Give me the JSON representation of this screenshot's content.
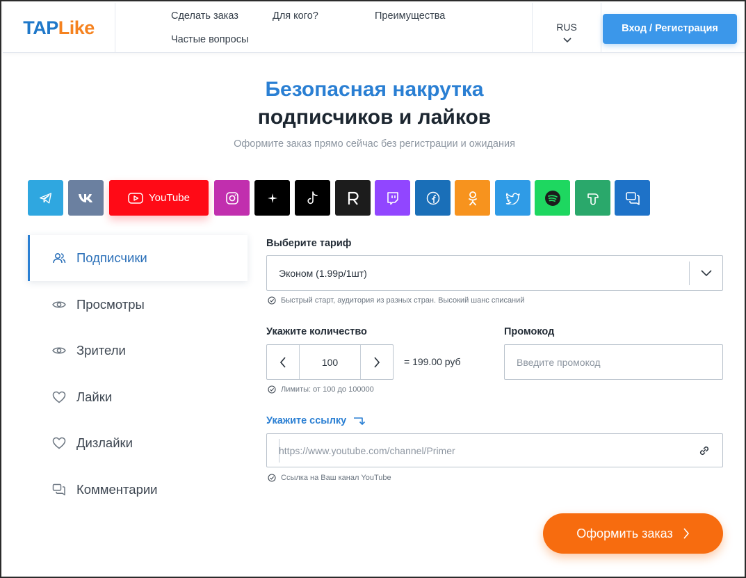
{
  "logo": {
    "part1": "TAP",
    "part2": "Like"
  },
  "nav": {
    "order": "Сделать заказ",
    "for_whom": "Для кого?",
    "advantages": "Преимущества",
    "faq": "Частые вопросы"
  },
  "language": "RUS",
  "login_label": "Вход / Регистрация",
  "hero": {
    "title_line1": "Безопасная накрутка",
    "title_line2": "подписчиков и лайков",
    "subtitle": "Оформите заказ прямо сейчас без регистрации и ожидания"
  },
  "platforms": [
    {
      "icon": "telegram-icon",
      "color": "#2fa7e0"
    },
    {
      "icon": "vk-icon",
      "color": "#6b80a0"
    },
    {
      "icon": "youtube-icon",
      "color": "#ff0a16",
      "label": "YouTube",
      "selected": true
    },
    {
      "icon": "instagram-icon",
      "color": "#c12fae"
    },
    {
      "icon": "threads-icon",
      "color": "#000000"
    },
    {
      "icon": "tiktok-icon",
      "color": "#000000"
    },
    {
      "icon": "rutube-icon",
      "color": "#1c1c1c"
    },
    {
      "icon": "twitch-icon",
      "color": "#9146ff"
    },
    {
      "icon": "facebook-icon",
      "color": "#1a6fb8"
    },
    {
      "icon": "odnoklassniki-icon",
      "color": "#f7931e"
    },
    {
      "icon": "twitter-icon",
      "color": "#2f9be6"
    },
    {
      "icon": "spotify-icon",
      "color": "#1ed760"
    },
    {
      "icon": "tenchat-icon",
      "color": "#2aa86b"
    },
    {
      "icon": "comments-icon",
      "color": "#1e72c8"
    }
  ],
  "services": [
    {
      "label": "Подписчики",
      "icon": "users-icon",
      "active": true
    },
    {
      "label": "Просмотры",
      "icon": "eye-icon",
      "active": false
    },
    {
      "label": "Зрители",
      "icon": "eye-icon",
      "active": false
    },
    {
      "label": "Лайки",
      "icon": "heart-icon",
      "active": false
    },
    {
      "label": "Дизлайки",
      "icon": "heart-icon",
      "active": false
    },
    {
      "label": "Комментарии",
      "icon": "comments-icon",
      "active": false
    }
  ],
  "form": {
    "tariff_label": "Выберите тариф",
    "tariff_value": "Эконом (1.99р/1шт)",
    "tariff_hint": "Быстрый старт, аудитория из разных стран. Высокий шанс списаний",
    "quantity_label": "Укажите количество",
    "quantity_value": "100",
    "total": "= 199.00 руб",
    "quantity_hint": "Лимиты: от 100 до 100000",
    "promo_label": "Промокод",
    "promo_placeholder": "Введите промокод",
    "link_label": "Укажите ссылку",
    "link_placeholder": "https://www.youtube.com/channel/Primer",
    "link_hint": "Ссылка на Ваш канал YouTube",
    "submit_label": "Оформить заказ"
  },
  "colors": {
    "brand_blue": "#2a7fd3",
    "brand_orange": "#f5821f",
    "cta_orange": "#f76c0f",
    "login_blue": "#3b97ea"
  }
}
